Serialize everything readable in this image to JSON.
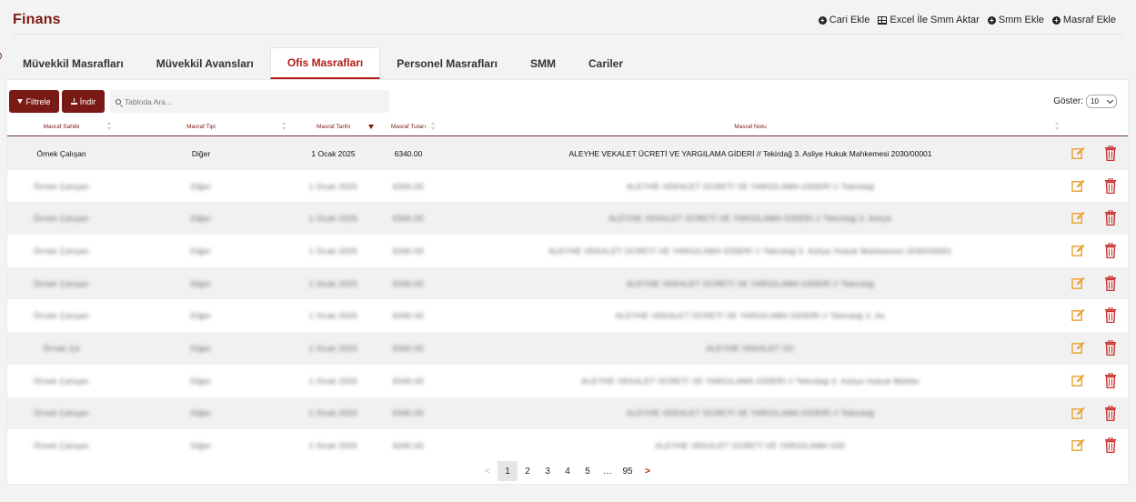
{
  "header": {
    "title": "Finans",
    "actions": [
      {
        "label": "Cari Ekle",
        "icon": "plus-circle-icon"
      },
      {
        "label": "Excel İle Smm Aktar",
        "icon": "table-icon"
      },
      {
        "label": "Smm Ekle",
        "icon": "plus-circle-icon"
      },
      {
        "label": "Masraf Ekle",
        "icon": "plus-circle-icon"
      }
    ]
  },
  "tabs": [
    {
      "label": "Müvekkil Masrafları",
      "active": false
    },
    {
      "label": "Müvekkil Avansları",
      "active": false
    },
    {
      "label": "Ofis Masrafları",
      "active": true
    },
    {
      "label": "Personel Masrafları",
      "active": false
    },
    {
      "label": "SMM",
      "active": false
    },
    {
      "label": "Cariler",
      "active": false
    }
  ],
  "toolbar": {
    "filter_label": "Filtrele",
    "download_label": "İndir",
    "search_placeholder": "Tabloda Ara...",
    "show_label": "Göster:",
    "page_size": "10"
  },
  "table": {
    "columns": [
      "Masraf Sahibi",
      "Masraf Tipi",
      "Masraf Tarihi",
      "Masraf Tutarı",
      "Masraf Notu"
    ],
    "rows": [
      {
        "owner": "Örnek Çalışan",
        "type": "Diğer",
        "date": "1 Ocak 2025",
        "amount": "6340.00",
        "note": "ALEYHE VEKALET ÜCRETİ VE YARGILAMA GİDERİ // Tekirdağ 3. Asliye Hukuk Mahkemesi 2030/00001",
        "blurred": false
      },
      {
        "owner": "Örnek Çalışan",
        "type": "Diğer",
        "date": "1 Ocak 2025",
        "amount": "6340.00",
        "note": "ALEYHE VEKALET ÜCRETİ VE YARGILAMA GİDERİ // Tekirdağ",
        "blurred": true
      },
      {
        "owner": "Örnek Çalışan",
        "type": "Diğer",
        "date": "1 Ocak 2025",
        "amount": "6340.00",
        "note": "ALEYHE VEKALET ÜCRETİ VE YARGILAMA GİDERİ // Tekirdağ 3. Asliye",
        "blurred": true
      },
      {
        "owner": "Örnek Çalışan",
        "type": "Diğer",
        "date": "1 Ocak 2025",
        "amount": "6340.00",
        "note": "ALEYHE VEKALET ÜCRETİ VE YARGILAMA GİDERİ // Tekirdağ 3. Asliye Hukuk Mahkemesi 2030/00001",
        "blurred": true
      },
      {
        "owner": "Örnek Çalışan",
        "type": "Diğer",
        "date": "1 Ocak 2025",
        "amount": "6340.00",
        "note": "ALEYHE VEKALET ÜCRETİ VE YARGILAMA GİDERİ // Tekirdağ",
        "blurred": true
      },
      {
        "owner": "Örnek Çalışan",
        "type": "Diğer",
        "date": "1 Ocak 2025",
        "amount": "6340.00",
        "note": "ALEYHE VEKALET ÜCRETİ VE YARGILAMA GİDERİ // Tekirdağ 3. As",
        "blurred": true
      },
      {
        "owner": "Örnek Ça",
        "type": "Diğer",
        "date": "1 Ocak 2025",
        "amount": "6340.00",
        "note": "ALEYHE VEKALET ÜC",
        "blurred": true
      },
      {
        "owner": "Örnek Çalışan",
        "type": "Diğer",
        "date": "1 Ocak 2025",
        "amount": "6340.00",
        "note": "ALEYHE VEKALET ÜCRETİ VE YARGILAMA GİDERİ // Tekirdağ 3. Asliye Hukuk Mahke",
        "blurred": true
      },
      {
        "owner": "Örnek Çalışan",
        "type": "Diğer",
        "date": "1 Ocak 2025",
        "amount": "6340.00",
        "note": "ALEYHE VEKALET ÜCRETİ VE YARGILAMA GİDERİ // Tekirdağ",
        "blurred": true
      },
      {
        "owner": "Örnek Çalışan",
        "type": "Diğer",
        "date": "1 Ocak 2025",
        "amount": "6340.00",
        "note": "ALEYHE VEKALET ÜCRETİ VE YARGILAMA GİD",
        "blurred": true
      }
    ]
  },
  "pagination": {
    "prev": "<",
    "pages": [
      "1",
      "2",
      "3",
      "4",
      "5",
      "…",
      "95"
    ],
    "current": "1",
    "next": ">"
  },
  "colors": {
    "brand": "#7a1a14",
    "accent": "#b11c16",
    "edit": "#e9a53a",
    "delete": "#c9302c"
  }
}
